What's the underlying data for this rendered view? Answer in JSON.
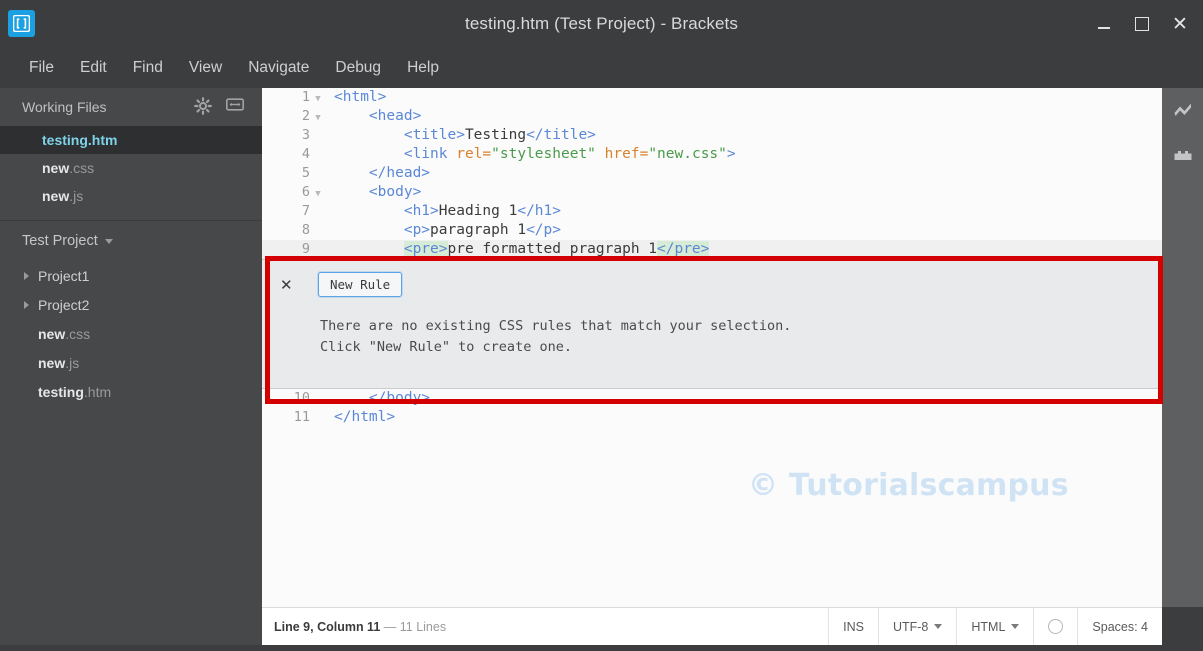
{
  "window": {
    "title": "testing.htm (Test Project) - Brackets",
    "app_icon": "brackets-logo-icon",
    "controls": {
      "minimize": "minimize-icon",
      "maximize": "maximize-icon",
      "close": "✕"
    }
  },
  "menubar": {
    "items": [
      {
        "label": "File"
      },
      {
        "label": "Edit"
      },
      {
        "label": "Find"
      },
      {
        "label": "View"
      },
      {
        "label": "Navigate"
      },
      {
        "label": "Debug"
      },
      {
        "label": "Help"
      }
    ]
  },
  "sidebar": {
    "working_files": {
      "title": "Working Files",
      "gear_icon": "gear-icon",
      "split_icon": "split-view-icon",
      "files": [
        {
          "name": "testing",
          "ext": ".htm",
          "active": true
        },
        {
          "name": "new",
          "ext": ".css",
          "active": false
        },
        {
          "name": "new",
          "ext": ".js",
          "active": false
        }
      ]
    },
    "project": {
      "name": "Test Project",
      "caret": "chevron-down-icon",
      "tree": [
        {
          "label": "Project1",
          "type": "folder"
        },
        {
          "label": "Project2",
          "type": "folder"
        },
        {
          "name": "new",
          "ext": ".css",
          "type": "file"
        },
        {
          "name": "new",
          "ext": ".js",
          "type": "file"
        },
        {
          "name": "testing",
          "ext": ".htm",
          "type": "file"
        }
      ]
    }
  },
  "editor": {
    "watermark": "© Tutorialscampus",
    "lines": [
      {
        "num": "1",
        "fold": true,
        "indent": 0,
        "tokens": [
          {
            "t": "tag",
            "v": "<html>"
          }
        ]
      },
      {
        "num": "2",
        "fold": true,
        "indent": 1,
        "tokens": [
          {
            "t": "tag",
            "v": "<head>"
          }
        ]
      },
      {
        "num": "3",
        "fold": false,
        "indent": 2,
        "tokens": [
          {
            "t": "tag",
            "v": "<title>"
          },
          {
            "t": "txt",
            "v": "Testing"
          },
          {
            "t": "tag",
            "v": "</title>"
          }
        ]
      },
      {
        "num": "4",
        "fold": false,
        "indent": 2,
        "tokens": [
          {
            "t": "tag",
            "v": "<link "
          },
          {
            "t": "attr",
            "v": "rel="
          },
          {
            "t": "str",
            "v": "\"stylesheet\""
          },
          {
            "t": "txt",
            "v": " "
          },
          {
            "t": "attr",
            "v": "href="
          },
          {
            "t": "str",
            "v": "\"new.css\""
          },
          {
            "t": "tag",
            "v": ">"
          }
        ]
      },
      {
        "num": "5",
        "fold": false,
        "indent": 1,
        "tokens": [
          {
            "t": "tag",
            "v": "</head>"
          }
        ]
      },
      {
        "num": "6",
        "fold": true,
        "indent": 1,
        "tokens": [
          {
            "t": "tag",
            "v": "<body>"
          }
        ]
      },
      {
        "num": "7",
        "fold": false,
        "indent": 2,
        "tokens": [
          {
            "t": "tag",
            "v": "<h1>"
          },
          {
            "t": "txt",
            "v": "Heading 1"
          },
          {
            "t": "tag",
            "v": "</h1>"
          }
        ]
      },
      {
        "num": "8",
        "fold": false,
        "indent": 2,
        "tokens": [
          {
            "t": "tag",
            "v": "<p>"
          },
          {
            "t": "txt",
            "v": "paragraph 1"
          },
          {
            "t": "tag",
            "v": "</p>"
          }
        ]
      },
      {
        "num": "9",
        "fold": false,
        "indent": 2,
        "current": true,
        "tokens": [
          {
            "t": "tag sel",
            "v": "<pre>"
          },
          {
            "t": "txt",
            "v": "pre formatted pragraph 1"
          },
          {
            "t": "tag sel",
            "v": "</pre>"
          }
        ]
      },
      {
        "num": "10",
        "fold": false,
        "indent": 1,
        "tokens": [
          {
            "t": "tag",
            "v": "</body>"
          }
        ]
      },
      {
        "num": "11",
        "fold": false,
        "indent": 0,
        "tokens": [
          {
            "t": "tag",
            "v": "</html>"
          }
        ]
      }
    ]
  },
  "inline_widget": {
    "close_label": "✕",
    "new_rule_label": "New Rule",
    "message_line1": "There are no existing CSS rules that match your selection.",
    "message_line2": "Click \"New Rule\" to create one."
  },
  "right_toolbar": {
    "items": [
      {
        "icon": "live-preview-bolt-icon"
      },
      {
        "icon": "extension-manager-icon"
      }
    ]
  },
  "statusbar": {
    "cursor": "Line 9, Column 11",
    "separator": "—",
    "line_count": "11 Lines",
    "insert_mode": "INS",
    "encoding": "UTF-8",
    "language": "HTML",
    "lint_icon": "lint-status-circle-icon",
    "indentation": "Spaces: 4"
  },
  "annotation": {
    "box_color": "#d40000"
  },
  "colors": {
    "chrome": "#3b3d3e",
    "sidebar": "#47484a",
    "sidebar_active": "#2d2f31",
    "accent_cyan": "#7fd3e8",
    "editor_bg": "#fbfbfb",
    "tag": "#5a87d6",
    "attr": "#d9822b",
    "string": "#4a9b4a",
    "watermark": "#cfe3f5",
    "annotation_red": "#d40000",
    "brackets_blue": "#1ba1e2"
  }
}
